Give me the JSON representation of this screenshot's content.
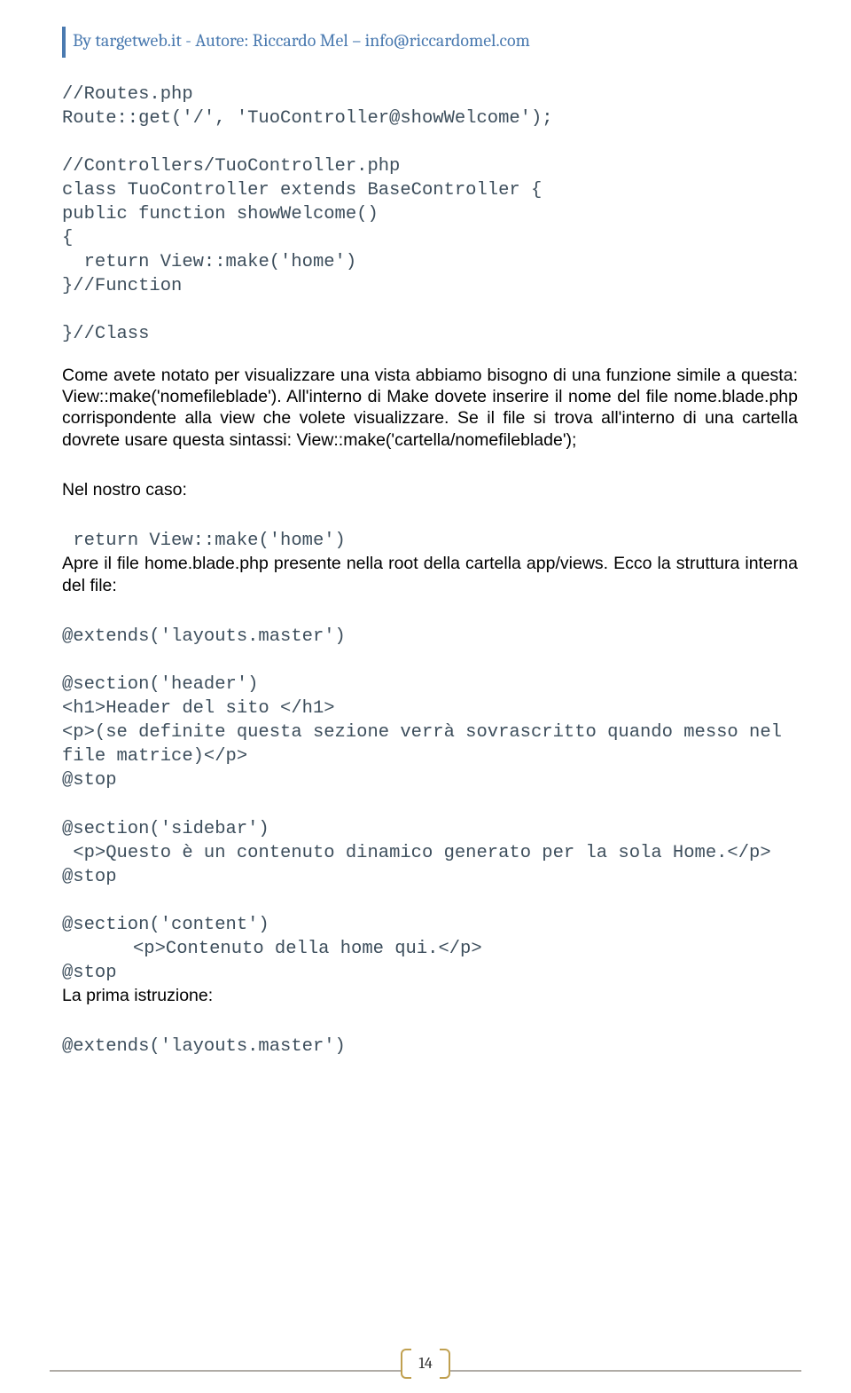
{
  "header": "By targetweb.it - Autore: Riccardo Mel – info@riccardomel.com",
  "code1": "//Routes.php\nRoute::get('/', 'TuoController@showWelcome');\n\n//Controllers/TuoController.php\nclass TuoController extends BaseController {\npublic function showWelcome()\n{\n  return View::make('home')\n}//Function\n\n}//Class",
  "para1": "Come avete notato per visualizzare una vista abbiamo bisogno di una funzione simile a questa: View::make('nomefileblade'). All'interno di Make dovete inserire il nome del file nome.blade.php corrispondente alla view che volete visualizzare. Se il file si trova all'interno di una cartella dovrete usare questa sintassi: View::make('cartella/nomefileblade');",
  "para2": "Nel nostro caso:",
  "code2": " return View::make('home')",
  "para3": "Apre il file home.blade.php presente nella root della cartella app/views. Ecco la struttura interna del file:",
  "code3": "@extends('layouts.master')\n\n@section('header')\n<h1>Header del sito </h1>\n<p>(se definite questa sezione verrà sovrascritto quando messo nel file matrice)</p>\n@stop\n\n@section('sidebar')\n <p>Questo è un contenuto dinamico generato per la sola Home.</p>\n@stop\n\n@section('content')",
  "code3_indent": "<p>Contenuto della home qui.</p>",
  "code3_end": "@stop",
  "para4": "La prima istruzione:",
  "code4": "@extends('layouts.master')",
  "page_number": "14"
}
